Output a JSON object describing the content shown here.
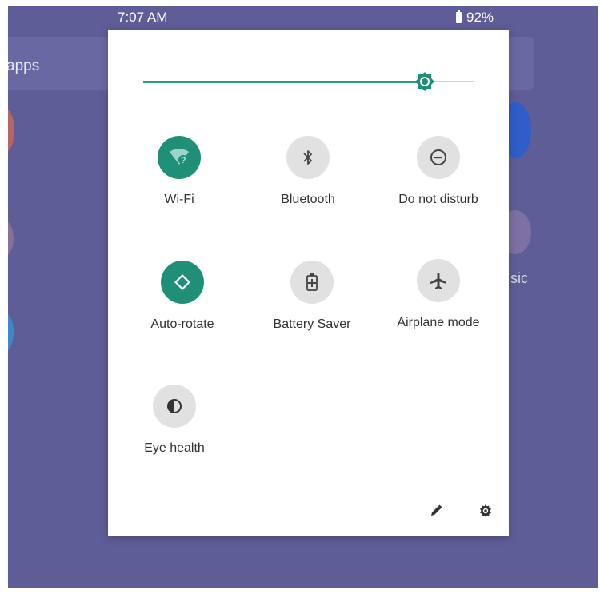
{
  "status_bar": {
    "time": "7:07 AM",
    "battery": "92%"
  },
  "background": {
    "search_hint": "apps",
    "app_label_partial": "sic"
  },
  "quick_settings": {
    "brightness_level": 0.86,
    "accent_color": "#1f8f78",
    "tiles": [
      {
        "label": "Wi-Fi",
        "icon": "wifi-question-icon",
        "state": "on"
      },
      {
        "label": "Bluetooth",
        "icon": "bluetooth-icon",
        "state": "off"
      },
      {
        "label": "Do not disturb",
        "icon": "do-not-disturb-icon",
        "state": "off"
      },
      {
        "label": "Auto-rotate",
        "icon": "auto-rotate-icon",
        "state": "on"
      },
      {
        "label": "Battery Saver",
        "icon": "battery-saver-icon",
        "state": "off"
      },
      {
        "label": "Airplane mode",
        "icon": "airplane-icon",
        "state": "off"
      },
      {
        "label": "Eye health",
        "icon": "eye-health-icon",
        "state": "off"
      }
    ],
    "footer": {
      "edit_icon": "pencil-icon",
      "settings_icon": "gear-icon"
    }
  }
}
